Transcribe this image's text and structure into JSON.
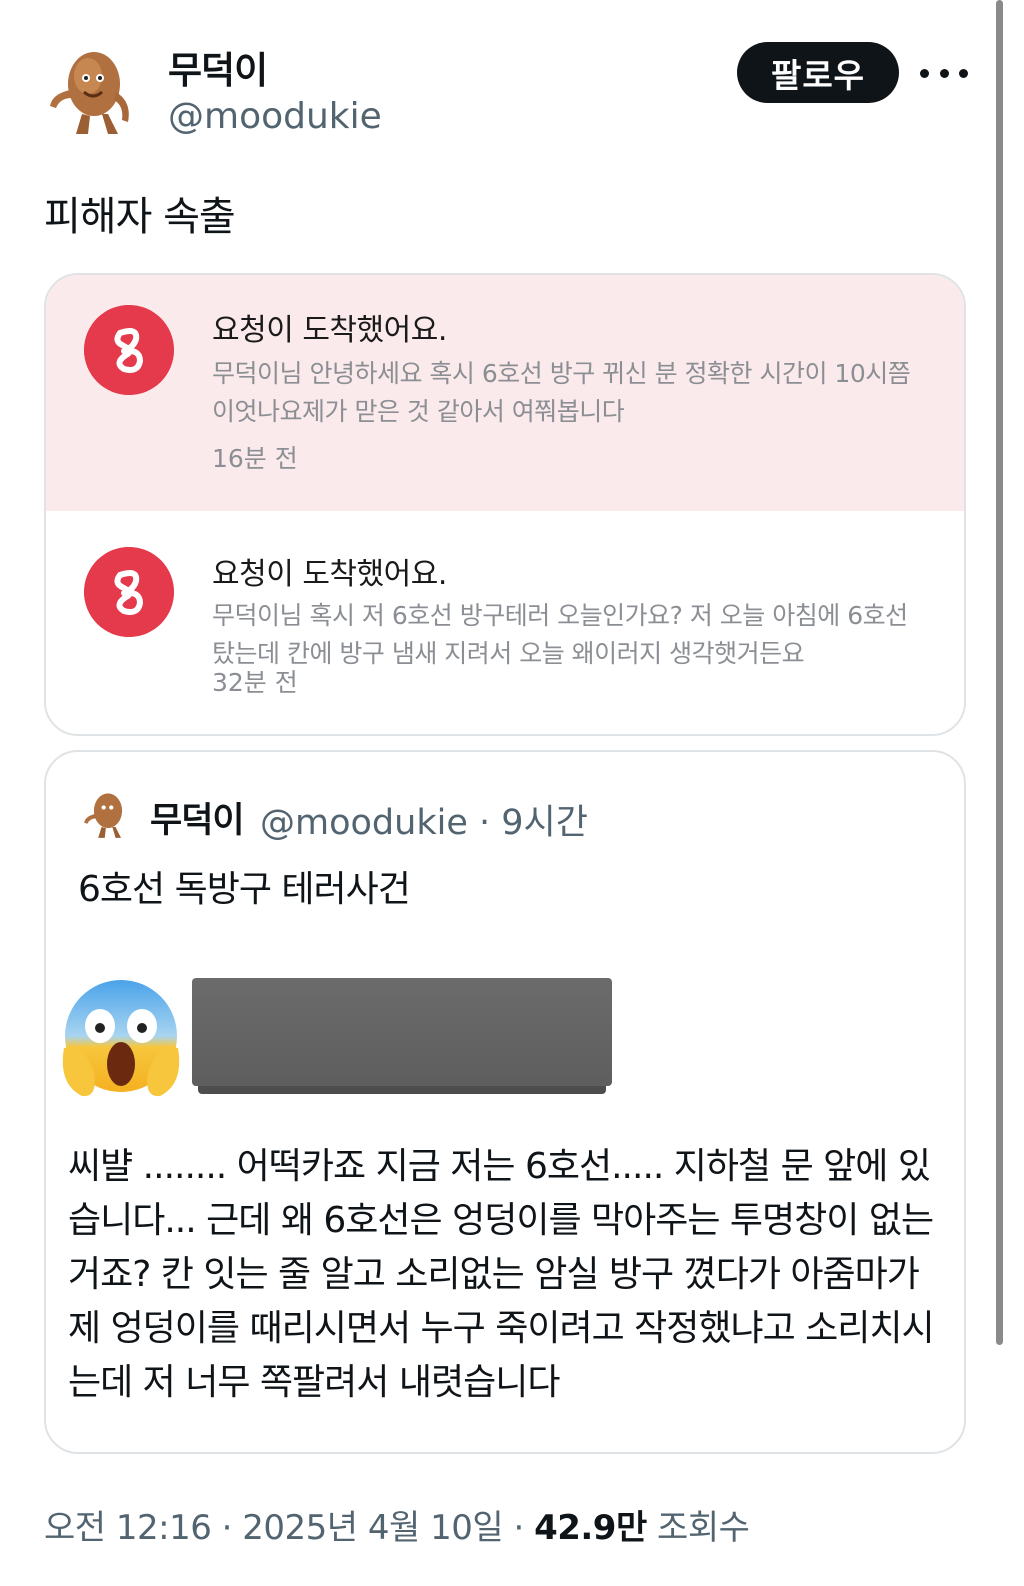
{
  "author": {
    "name": "무덕이",
    "handle": "@moodukie"
  },
  "follow_label": "팔로우",
  "tweet_text": "피해자 속출",
  "notifications": [
    {
      "title": "요청이 도착했어요.",
      "body": "무덕이님 안녕하세요 혹시 6호선 방구 뀌신 분 정확한 시간이 10시쯤이엇나요제가 맏은 것 같아서 여쭤봅니다",
      "time": "16분 전",
      "icon": "app-logo-icon"
    },
    {
      "title": "요청이 도착했어요.",
      "body": "무덕이님 혹시 저 6호선 방구테러 오늘인가요? 저 오늘 아침에 6호선 탔는데 칸에 방구 냄새 지려서 오늘 왜이러지 생각햇거든요",
      "time": "32분 전",
      "icon": "app-logo-icon"
    }
  ],
  "quote": {
    "name": "무덕이",
    "handle_time": "@moodukie · 9시간",
    "headline": "6호선 독방구 테러사건",
    "emoji": "screaming-face-icon",
    "body": "씨뱔 ........ 어떡카죠 지금 저는 6호선..... 지하철 문 앞에 있습니다... 근데 왜 6호선은 엉덩이를 막아주는 투명창이 없는 거죠? 칸 잇는 줄 알고 소리없는 암실 방구 꼈다가 아줌마가 제 엉덩이를 때리시면서 누구 죽이려고 작정했냐고 소리치시는데 저 너무 쪽팔려서 내렷습니다"
  },
  "meta": {
    "datetime": "오전 12:16 · 2025년 4월 10일 · ",
    "views": "42.9만",
    "views_label": " 조회수"
  },
  "colors": {
    "accent": "#e53a4b",
    "notif_highlight_bg": "#fbeaec",
    "follow_bg": "#0f1419"
  }
}
